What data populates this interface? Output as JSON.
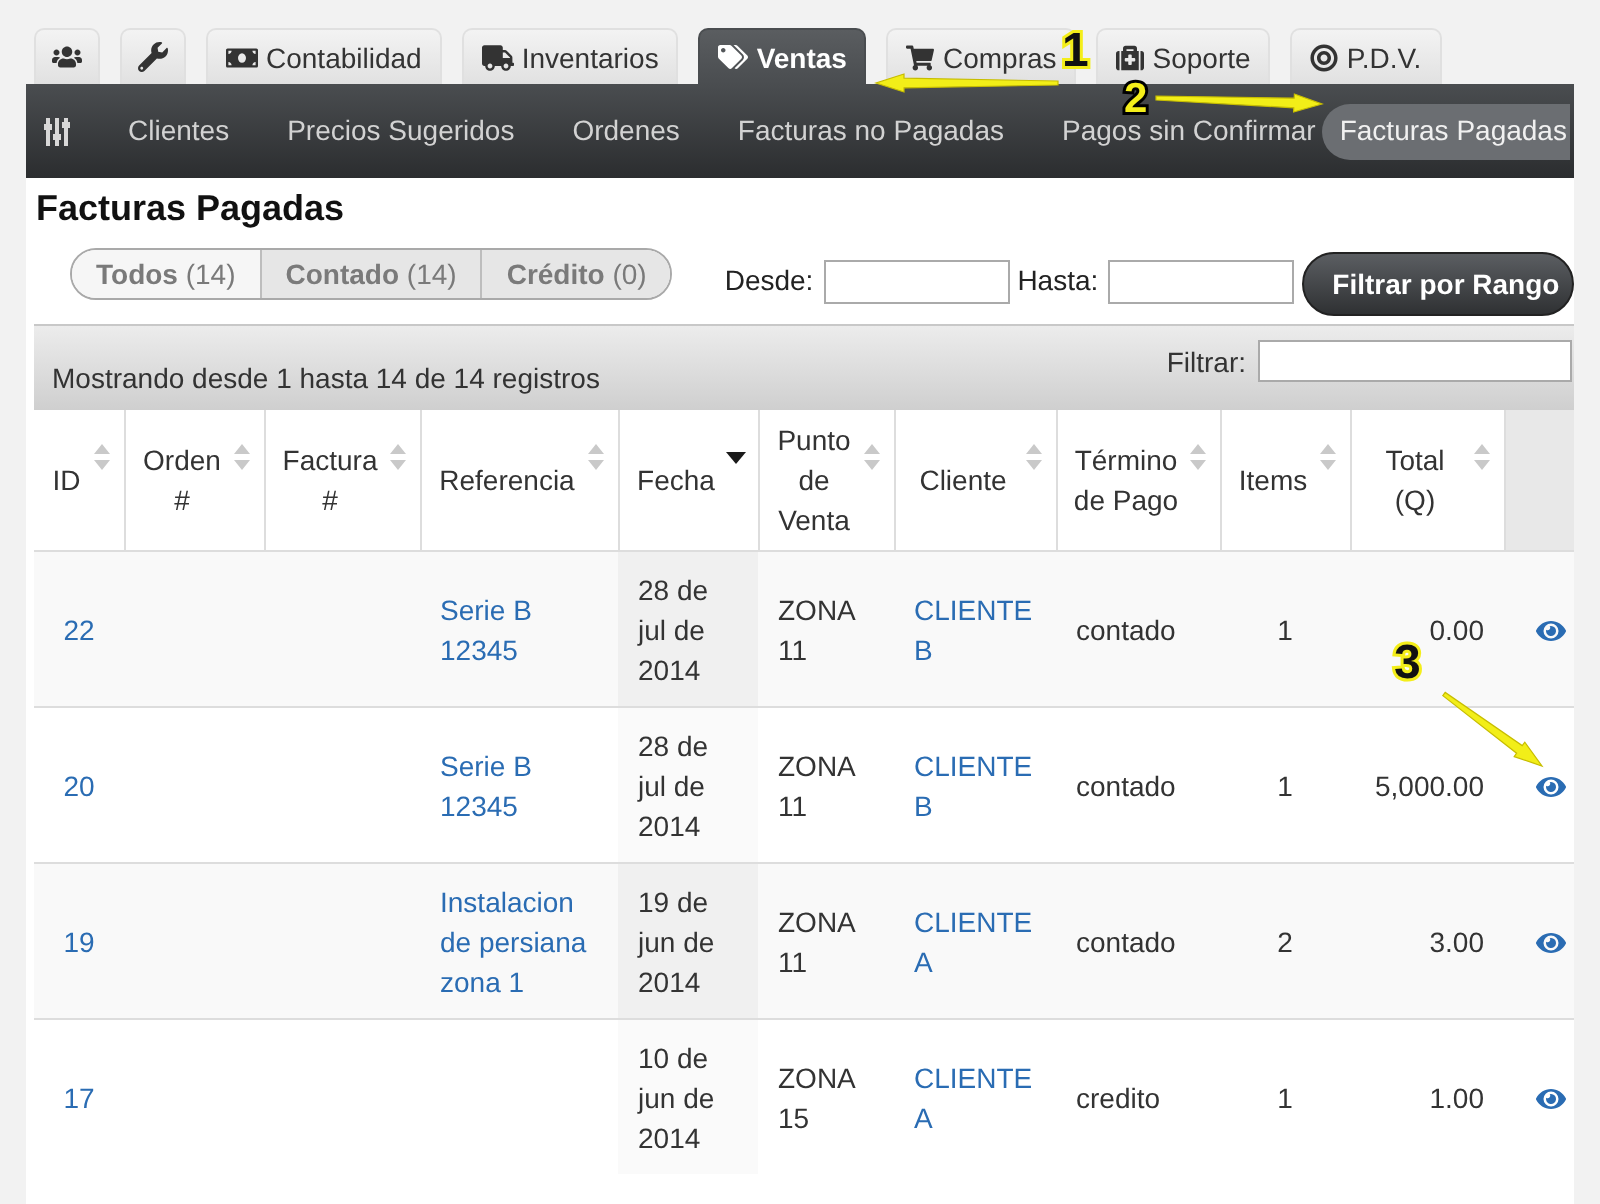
{
  "tabs": [
    {
      "selected": false
    },
    {
      "selected": false
    },
    {
      "label": "Contabilidad",
      "selected": false
    },
    {
      "label": "Inventarios",
      "selected": false
    },
    {
      "label": "Ventas",
      "selected": true
    },
    {
      "label": "Compras",
      "selected": false
    },
    {
      "label": "Soporte",
      "selected": false
    },
    {
      "label": "P.D.V.",
      "selected": false
    }
  ],
  "nav": {
    "items": [
      {
        "label": "Clientes",
        "selected": false
      },
      {
        "label": "Precios Sugeridos",
        "selected": false
      },
      {
        "label": "Ordenes",
        "selected": false
      },
      {
        "label": "Facturas no Pagadas",
        "selected": false
      },
      {
        "label": "Pagos sin Confirmar",
        "selected": false
      },
      {
        "label": "Facturas Pagadas",
        "selected": true
      }
    ]
  },
  "page_title": "Facturas Pagadas",
  "segments": [
    {
      "label": "**Todos** (14)",
      "selected": true
    },
    {
      "label": "**Contado** (14)",
      "selected": false
    },
    {
      "label": "**Crédito** (0)",
      "selected": false
    }
  ],
  "date_filter": {
    "from_label": "Desde:",
    "to_label": "Hasta:",
    "button": "Filtrar por Rango"
  },
  "table": {
    "info": "Mostrando desde 1 hasta 14 de 14 registros",
    "search_label": "Filtrar:",
    "columns": [
      {
        "label": "ID",
        "sorted": false
      },
      {
        "label": "Orden #",
        "sorted": false
      },
      {
        "label": "Factura #",
        "sorted": false
      },
      {
        "label": "Referencia",
        "sorted": false
      },
      {
        "label": "Fecha",
        "sorted": true
      },
      {
        "label": "Punto de Venta",
        "sorted": false
      },
      {
        "label": "Cliente",
        "sorted": false
      },
      {
        "label": "Término de Pago",
        "sorted": false
      },
      {
        "label": "Items",
        "sorted": false
      },
      {
        "label": "Total (Q)",
        "sorted": false
      }
    ],
    "rows": [
      {
        "id": "22",
        "referencia": "Serie B 12345",
        "fecha": "28 de jul de 2014",
        "punto_de_venta": "ZONA 11",
        "cliente": "CLIENTE B",
        "termino_de_pago": "contado",
        "items": "1",
        "total": "0.00"
      },
      {
        "id": "20",
        "referencia": "Serie B 12345",
        "fecha": "28 de jul de 2014",
        "punto_de_venta": "ZONA 11",
        "cliente": "CLIENTE B",
        "termino_de_pago": "contado",
        "items": "1",
        "total": "5,000.00"
      },
      {
        "id": "19",
        "referencia": "Instalacion de persiana zona 1",
        "fecha": "19 de jun de 2014",
        "punto_de_venta": "ZONA 11",
        "cliente": "CLIENTE A",
        "termino_de_pago": "contado",
        "items": "2",
        "total": "3.00"
      },
      {
        "id": "17",
        "fecha": "10 de jun de 2014",
        "punto_de_venta": "ZONA 15",
        "cliente": "CLIENTE A",
        "termino_de_pago": "credito",
        "items": "1",
        "total": "1.00"
      }
    ]
  },
  "annotations": [
    {
      "number": "1"
    },
    {
      "number": "2"
    },
    {
      "number": "3"
    }
  ]
}
